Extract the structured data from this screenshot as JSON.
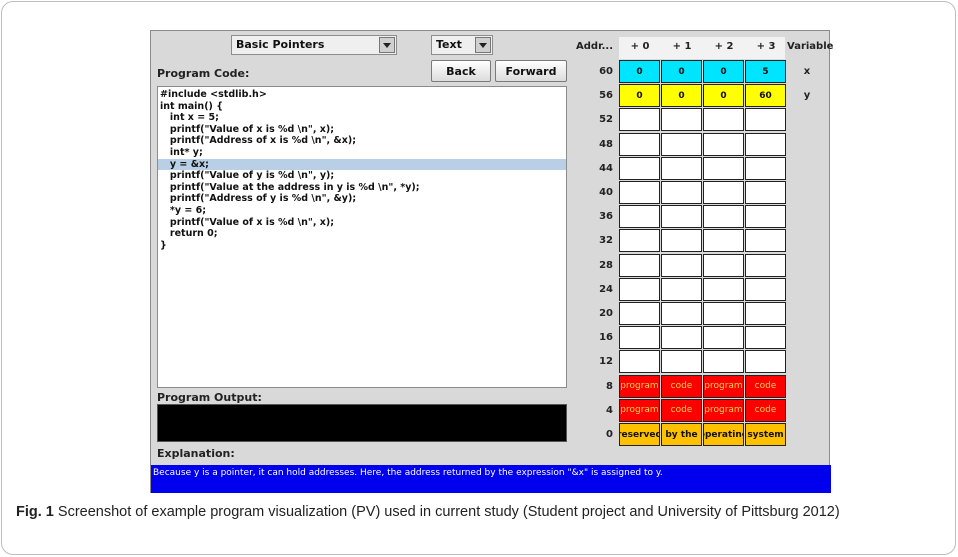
{
  "example_select": {
    "value": "Basic Pointers"
  },
  "mode_select": {
    "value": "Text"
  },
  "labels": {
    "program_code": "Program Code:",
    "program_output": "Program Output:",
    "explanation": "Explanation:"
  },
  "buttons": {
    "back": "Back",
    "forward": "Forward"
  },
  "code": {
    "lines": [
      "#include <stdlib.h>",
      "int main() {",
      "   int x = 5;",
      "   printf(\"Value of x is %d \\n\", x);",
      "   printf(\"Address of x is %d \\n\", &x);",
      "   int* y;",
      "   y = &x;",
      "   printf(\"Value of y is %d \\n\", y);",
      "   printf(\"Value at the address in y is %d \\n\", *y);",
      "   printf(\"Address of y is %d \\n\", &y);",
      "   *y = 6;",
      "   printf(\"Value of x is %d \\n\", x);",
      "   return 0;",
      "}"
    ],
    "highlighted_line": 6
  },
  "program_output": "",
  "explanation_text": "Because y is a pointer, it can hold addresses. Here, the address returned by the expression \"&x\" is assigned to y.",
  "memory": {
    "header": {
      "address": "Addr...",
      "offsets": [
        "+ 0",
        "+ 1",
        "+ 2",
        "+ 3"
      ],
      "variable": "Variable"
    },
    "rows": [
      {
        "address": "60",
        "cells": [
          "0",
          "0",
          "0",
          "5"
        ],
        "variable": "x",
        "color": "#00e5ff"
      },
      {
        "address": "56",
        "cells": [
          "0",
          "0",
          "0",
          "60"
        ],
        "variable": "y",
        "color": "#ffff00"
      },
      {
        "address": "52",
        "cells": [
          "",
          "",
          "",
          ""
        ],
        "variable": "",
        "color": "#ffffff"
      },
      {
        "address": "48",
        "cells": [
          "",
          "",
          "",
          ""
        ],
        "variable": "",
        "color": "#ffffff"
      },
      {
        "address": "44",
        "cells": [
          "",
          "",
          "",
          ""
        ],
        "variable": "",
        "color": "#ffffff"
      },
      {
        "address": "40",
        "cells": [
          "",
          "",
          "",
          ""
        ],
        "variable": "",
        "color": "#ffffff"
      },
      {
        "address": "36",
        "cells": [
          "",
          "",
          "",
          ""
        ],
        "variable": "",
        "color": "#ffffff"
      },
      {
        "address": "32",
        "cells": [
          "",
          "",
          "",
          ""
        ],
        "variable": "",
        "color": "#ffffff"
      },
      {
        "address": "28",
        "cells": [
          "",
          "",
          "",
          ""
        ],
        "variable": "",
        "color": "#ffffff"
      },
      {
        "address": "24",
        "cells": [
          "",
          "",
          "",
          ""
        ],
        "variable": "",
        "color": "#ffffff"
      },
      {
        "address": "20",
        "cells": [
          "",
          "",
          "",
          ""
        ],
        "variable": "",
        "color": "#ffffff"
      },
      {
        "address": "16",
        "cells": [
          "",
          "",
          "",
          ""
        ],
        "variable": "",
        "color": "#ffffff"
      },
      {
        "address": "12",
        "cells": [
          "",
          "",
          "",
          ""
        ],
        "variable": "",
        "color": "#ffffff"
      },
      {
        "address": "8",
        "cells": [
          "program",
          "code",
          "program",
          "code"
        ],
        "variable": "",
        "color": "#ff0000"
      },
      {
        "address": "4",
        "cells": [
          "program",
          "code",
          "program",
          "code"
        ],
        "variable": "",
        "color": "#ff0000"
      },
      {
        "address": "0",
        "cells": [
          "reserved",
          "by the",
          "operating",
          "system"
        ],
        "variable": "",
        "color": "#ffc000"
      }
    ]
  },
  "caption": {
    "label": "Fig. 1",
    "text": "Screenshot of example program visualization (PV) used in current study (Student project and University of Pittsburg 2012)"
  }
}
